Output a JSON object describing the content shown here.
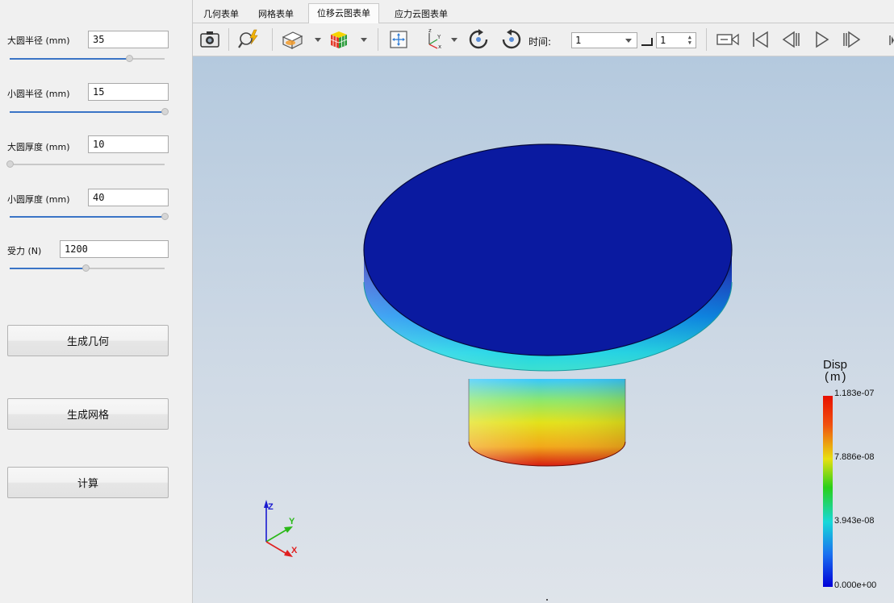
{
  "tabs": [
    "几何表单",
    "网格表单",
    "位移云图表单",
    "应力云图表单"
  ],
  "active_tab_index": 2,
  "params": [
    {
      "label": "大圆半径 (mm)",
      "value": "35",
      "slider": 0.77
    },
    {
      "label": "小圆半径 (mm)",
      "value": "15",
      "slider": 1.0
    },
    {
      "label": "大圆厚度 (mm)",
      "value": "10",
      "slider": 0.0
    },
    {
      "label": "小圆厚度 (mm)",
      "value": "40",
      "slider": 1.0
    },
    {
      "label": "受力 (N)",
      "value": "1200",
      "slider": 0.49
    }
  ],
  "buttons": {
    "generate_geometry": "生成几何",
    "generate_mesh": "生成网格",
    "compute": "计算"
  },
  "toolbar": {
    "time_label": "时间:",
    "time_value": "1",
    "step_value": "1",
    "icons": [
      "camera-icon",
      "zoom-lightning-icon",
      "clip-plane-icon",
      "color-cube-icon",
      "fit-view-icon",
      "axes-orientation-icon",
      "rotate-cw-icon",
      "rotate-ccw-icon",
      "record-video-icon",
      "first-frame-icon",
      "previous-frame-icon",
      "play-icon",
      "next-frame-icon"
    ]
  },
  "legend": {
    "title_line1": "Disp",
    "title_line2": "(m)",
    "max_label": "1.183e-07",
    "label_2": "7.886e-08",
    "label_3": "3.943e-08",
    "min_label": "0.000e+00"
  },
  "axes": {
    "z": "Z",
    "y": "Y",
    "x": "X"
  },
  "colors": {
    "accent": "#3a74c6",
    "top_face": "#0a1aa0",
    "legend_max": "#e81000",
    "legend_min": "#0000d8"
  }
}
